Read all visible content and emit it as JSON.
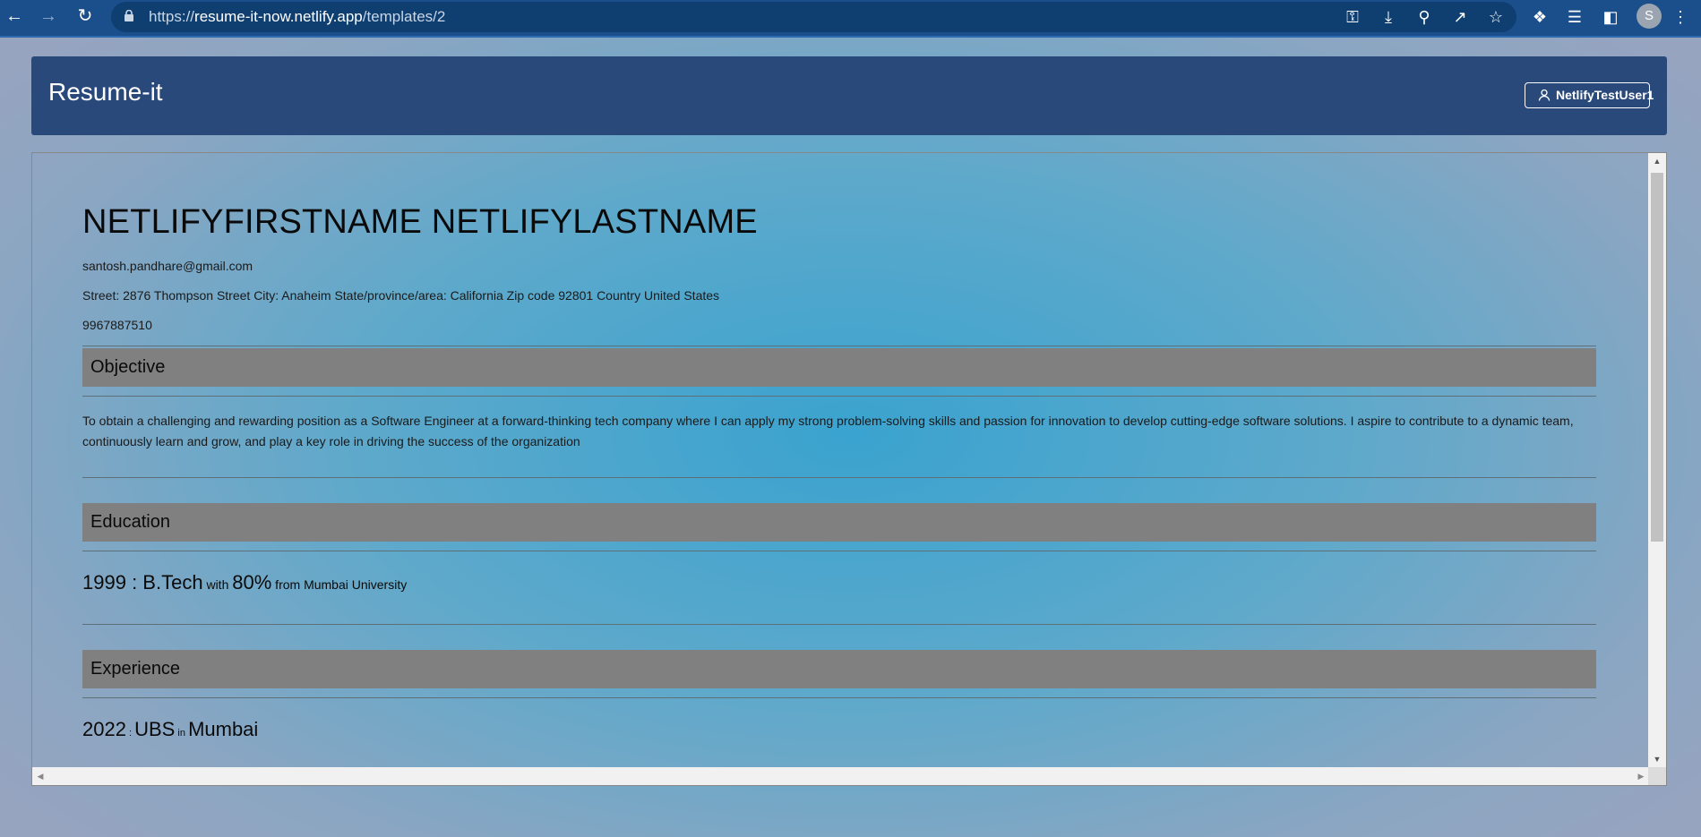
{
  "browser": {
    "url_prefix": "https://",
    "url_host": "resume-it-now.netlify.app",
    "url_path": "/templates/2",
    "profile_initial": "S",
    "chrome_color": "#1a4f8b"
  },
  "app": {
    "title": "Resume-it",
    "user_label": "NetlifyTestUser1",
    "header_color": "#29497a"
  },
  "resume": {
    "full_name": "NETLIFYFIRSTNAME NETLIFYLASTNAME",
    "email": "santosh.pandhare@gmail.com",
    "address": "Street: 2876 Thompson Street City: Anaheim State/province/area: California Zip code 92801 Country United States",
    "phone": "9967887510",
    "sections": {
      "objective": {
        "title": "Objective",
        "text": "To obtain a challenging and rewarding position as a Software Engineer at a forward-thinking tech company where I can apply my strong problem-solving skills and passion for innovation to develop cutting-edge software solutions. I aspire to contribute to a dynamic team, continuously learn and grow, and play a key role in driving the success of the organization"
      },
      "education": {
        "title": "Education",
        "year": "1999",
        "sep": " : ",
        "degree": "B.Tech",
        "with_word": " with ",
        "score": "80%",
        "from_text": " from Mumbai University"
      },
      "experience": {
        "title": "Experience",
        "year": "2022",
        "sep": " : ",
        "company": "UBS",
        "in_word": " in ",
        "location": "Mumbai"
      }
    },
    "section_header_color": "#808080"
  }
}
